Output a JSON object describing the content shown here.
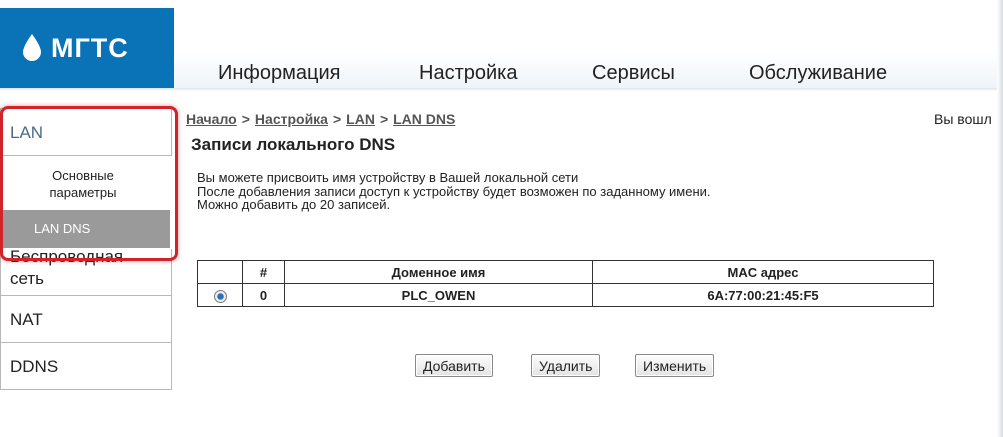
{
  "brand": {
    "logo_text": "МГТС",
    "color": "#0a73b7"
  },
  "topnav": {
    "items": [
      {
        "label": "Информация"
      },
      {
        "label": "Настройка"
      },
      {
        "label": "Сервисы"
      },
      {
        "label": "Обслуживание"
      }
    ]
  },
  "sidebar": {
    "lan": "LAN",
    "sub_basic": "Основные параметры",
    "sub_lan_dns": "LAN DNS",
    "wireless": "Беспроводная сеть",
    "nat": "NAT",
    "ddns": "DDNS",
    "highlight_color": "#d2232a"
  },
  "breadcrumb": {
    "items": [
      "Начало",
      "Настройка",
      "LAN",
      "LAN DNS"
    ],
    "separator": ">"
  },
  "login_text": "Вы вошл",
  "page_title": "Записи локального DNS",
  "description": {
    "line1": "Вы можете присвоить имя устройству в Вашей локальной сети",
    "line2": "После добавления записи доступ к устройству будет возможен по заданному имени.",
    "line3": "Можно добавить до 20 записей."
  },
  "table": {
    "headers": [
      "",
      "#",
      "Доменное имя",
      "MAC адрес"
    ],
    "rows": [
      {
        "selected": true,
        "index": "0",
        "domain": "PLC_OWEN",
        "mac": "6A:77:00:21:45:F5"
      }
    ]
  },
  "buttons": {
    "add": "Добавить",
    "delete": "Удалить",
    "edit": "Изменить"
  }
}
